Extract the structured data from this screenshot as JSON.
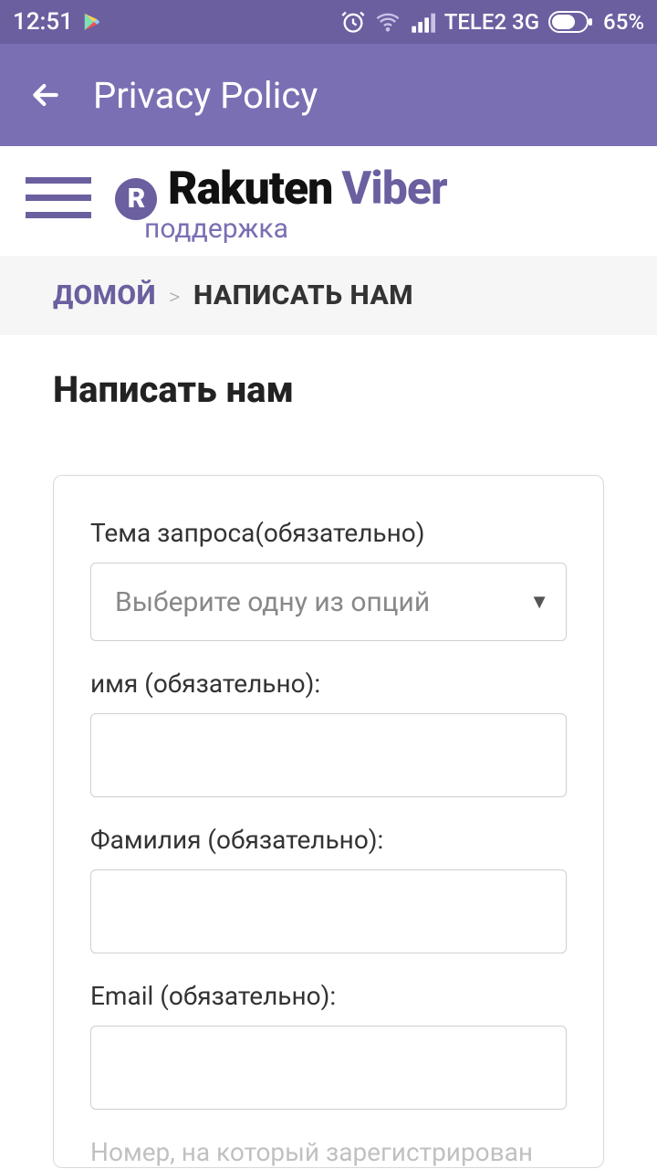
{
  "status": {
    "time": "12:51",
    "carrier": "TELE2 3G",
    "battery": "65%"
  },
  "appbar": {
    "title": "Privacy Policy"
  },
  "siteheader": {
    "logo_brand1": "Rakuten",
    "logo_brand2": "Viber",
    "subtitle": "поддержка"
  },
  "breadcrumb": {
    "home": "ДОМОЙ",
    "separator": ">",
    "current": "НАПИСАТЬ НАМ"
  },
  "page": {
    "title": "Написать нам"
  },
  "form": {
    "subject_label": "Тема запроса(обязательно)",
    "subject_placeholder": "Выберите одну из опций",
    "firstname_label": "имя (обязательно):",
    "firstname_value": "",
    "lastname_label": "Фамилия (обязательно):",
    "lastname_value": "",
    "email_label": "Email (обязательно):",
    "email_value": "",
    "phone_label": "Номер, на который зарегистрирован"
  }
}
